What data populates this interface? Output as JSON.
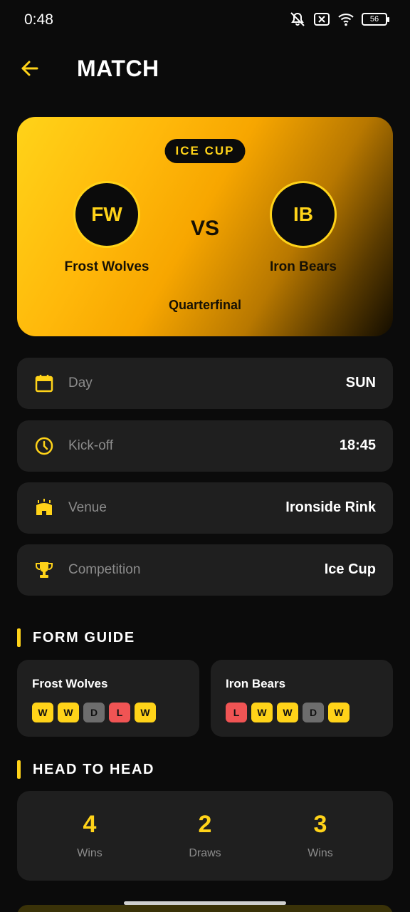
{
  "status_bar": {
    "time": "0:48",
    "battery": "56"
  },
  "header": {
    "title": "MATCH"
  },
  "match": {
    "competition_badge": "ICE CUP",
    "home": {
      "abbr": "FW",
      "name": "Frost Wolves"
    },
    "away": {
      "abbr": "IB",
      "name": "Iron Bears"
    },
    "vs": "VS",
    "stage": "Quarterfinal"
  },
  "info": [
    {
      "icon": "calendar-icon",
      "label": "Day",
      "value": "SUN"
    },
    {
      "icon": "clock-icon",
      "label": "Kick-off",
      "value": "18:45"
    },
    {
      "icon": "stadium-icon",
      "label": "Venue",
      "value": "Ironside Rink"
    },
    {
      "icon": "trophy-icon",
      "label": "Competition",
      "value": "Ice Cup"
    }
  ],
  "form_guide": {
    "title": "FORM GUIDE",
    "teams": [
      {
        "name": "Frost Wolves",
        "results": [
          "W",
          "W",
          "D",
          "L",
          "W"
        ]
      },
      {
        "name": "Iron Bears",
        "results": [
          "L",
          "W",
          "W",
          "D",
          "W"
        ]
      }
    ]
  },
  "head_to_head": {
    "title": "HEAD TO HEAD",
    "stats": [
      {
        "value": "4",
        "label": "Wins"
      },
      {
        "value": "2",
        "label": "Draws"
      },
      {
        "value": "3",
        "label": "Wins"
      }
    ]
  },
  "colors": {
    "accent": "#ffd319",
    "card": "#1f1f1f",
    "background": "#0b0b0b",
    "win": "#ffd319",
    "draw": "#6d6d6d",
    "loss": "#f05454"
  }
}
